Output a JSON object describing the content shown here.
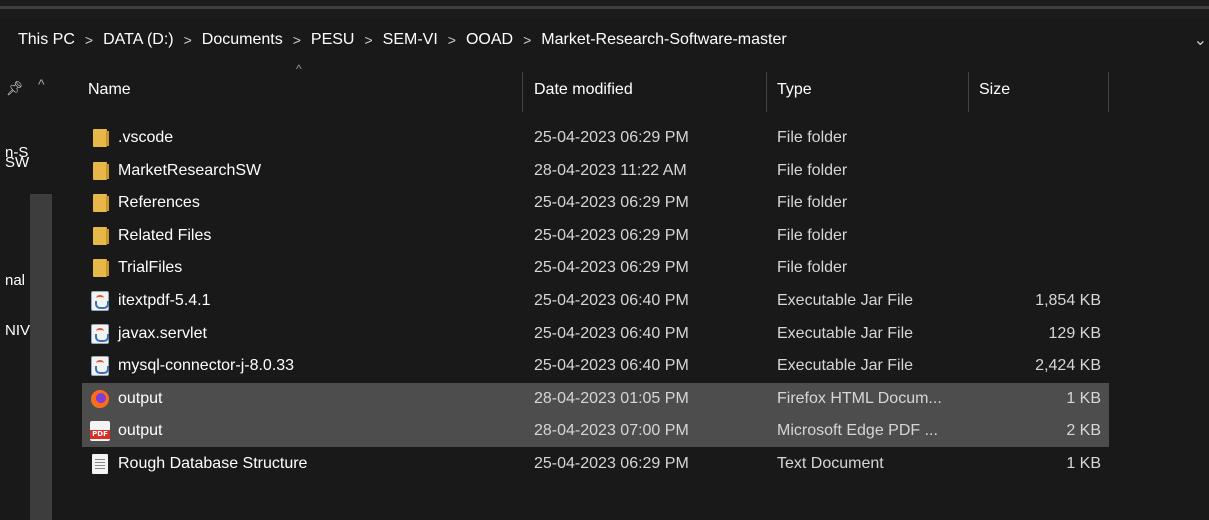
{
  "breadcrumb": [
    "This PC",
    "DATA (D:)",
    "Documents",
    "PESU",
    "SEM-VI",
    "OOAD",
    "Market-Research-Software-master"
  ],
  "breadcrumb_separator": ">",
  "nav_pane": {
    "labels": [
      "n-S",
      "SW",
      "nal",
      "NIV"
    ]
  },
  "columns": {
    "name": "Name",
    "date": "Date modified",
    "type": "Type",
    "size": "Size"
  },
  "files": [
    {
      "icon": "folder-icon",
      "name": ".vscode",
      "date": "25-04-2023 06:29 PM",
      "type": "File folder",
      "size": "",
      "selected": false
    },
    {
      "icon": "folder-icon",
      "name": "MarketResearchSW",
      "date": "28-04-2023 11:22 AM",
      "type": "File folder",
      "size": "",
      "selected": false
    },
    {
      "icon": "folder-icon",
      "name": "References",
      "date": "25-04-2023 06:29 PM",
      "type": "File folder",
      "size": "",
      "selected": false
    },
    {
      "icon": "folder-icon",
      "name": "Related Files",
      "date": "25-04-2023 06:29 PM",
      "type": "File folder",
      "size": "",
      "selected": false
    },
    {
      "icon": "folder-icon",
      "name": "TrialFiles",
      "date": "25-04-2023 06:29 PM",
      "type": "File folder",
      "size": "",
      "selected": false
    },
    {
      "icon": "jar-file-icon",
      "name": "itextpdf-5.4.1",
      "date": "25-04-2023 06:40 PM",
      "type": "Executable Jar File",
      "size": "1,854 KB",
      "selected": false
    },
    {
      "icon": "jar-file-icon",
      "name": "javax.servlet",
      "date": "25-04-2023 06:40 PM",
      "type": "Executable Jar File",
      "size": "129 KB",
      "selected": false
    },
    {
      "icon": "jar-file-icon",
      "name": "mysql-connector-j-8.0.33",
      "date": "25-04-2023 06:40 PM",
      "type": "Executable Jar File",
      "size": "2,424 KB",
      "selected": false
    },
    {
      "icon": "firefox-html-icon",
      "name": "output",
      "date": "28-04-2023 01:05 PM",
      "type": "Firefox HTML Docum...",
      "size": "1 KB",
      "selected": true
    },
    {
      "icon": "pdf-file-icon",
      "name": "output",
      "date": "28-04-2023 07:00 PM",
      "type": "Microsoft Edge PDF ...",
      "size": "2 KB",
      "selected": true
    },
    {
      "icon": "text-file-icon",
      "name": "Rough Database Structure",
      "date": "25-04-2023 06:29 PM",
      "type": "Text Document",
      "size": "1 KB",
      "selected": false
    }
  ],
  "colors": {
    "background": "#191919",
    "selected_row": "#4d4d4d",
    "folder": "#e8b74a",
    "text": "#ffffff",
    "secondary_text": "#d6d6d6"
  }
}
